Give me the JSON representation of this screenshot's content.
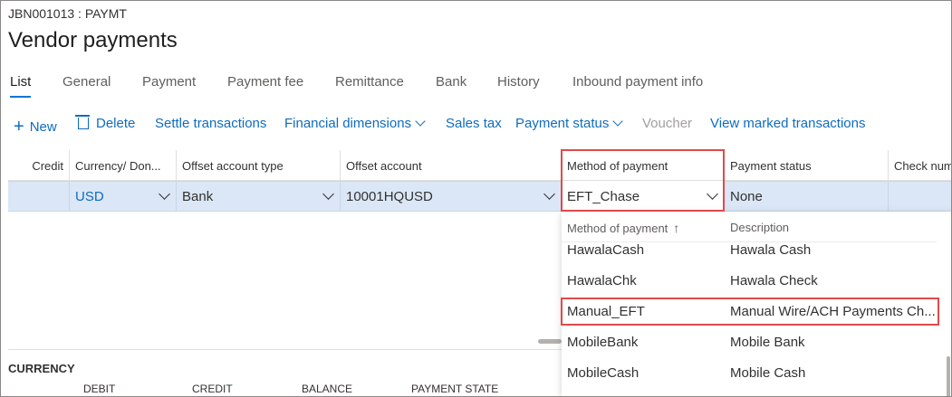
{
  "header": {
    "company": "JBN001013 : PAYMT",
    "title": "Vendor payments"
  },
  "tabs": [
    {
      "label": "List",
      "active": true
    },
    {
      "label": "General"
    },
    {
      "label": "Payment"
    },
    {
      "label": "Payment fee"
    },
    {
      "label": "Remittance"
    },
    {
      "label": "Bank"
    },
    {
      "label": "History"
    },
    {
      "label": "Inbound payment info"
    }
  ],
  "actions": {
    "new": "New",
    "delete": "Delete",
    "settle": "Settle transactions",
    "financial_dimensions": "Financial dimensions",
    "sales_tax": "Sales tax",
    "payment_status": "Payment status",
    "voucher": "Voucher",
    "view_marked": "View marked transactions"
  },
  "grid": {
    "columns": {
      "credit": "Credit",
      "currency": "Currency/ Don...",
      "offset_type": "Offset account type",
      "offset_account": "Offset account",
      "method": "Method of payment",
      "status": "Payment status",
      "check": "Check num"
    },
    "row": {
      "currency": "USD",
      "offset_type": "Bank",
      "offset_account": "10001HQUSD",
      "method": "EFT_Chase",
      "status": "None"
    }
  },
  "dropdown": {
    "col_method": "Method of payment",
    "col_description": "Description",
    "sort_arrow": "↑",
    "items": [
      {
        "method": "HawalaCash",
        "description": "Hawala Cash"
      },
      {
        "method": "HawalaChk",
        "description": "Hawala Check"
      },
      {
        "method": "Manual_EFT",
        "description": "Manual Wire/ACH Payments Ch..."
      },
      {
        "method": "MobileBank",
        "description": "Mobile Bank"
      },
      {
        "method": "MobileCash",
        "description": "Mobile Cash"
      }
    ]
  },
  "summary": {
    "title": "CURRENCY",
    "columns": [
      "DEBIT",
      "CREDIT",
      "BALANCE",
      "PAYMENT STATE"
    ]
  },
  "colors": {
    "accent": "#0078d4",
    "link": "#0f6cbd",
    "selection": "#dbe7f6",
    "highlight": "#e04a4a"
  }
}
